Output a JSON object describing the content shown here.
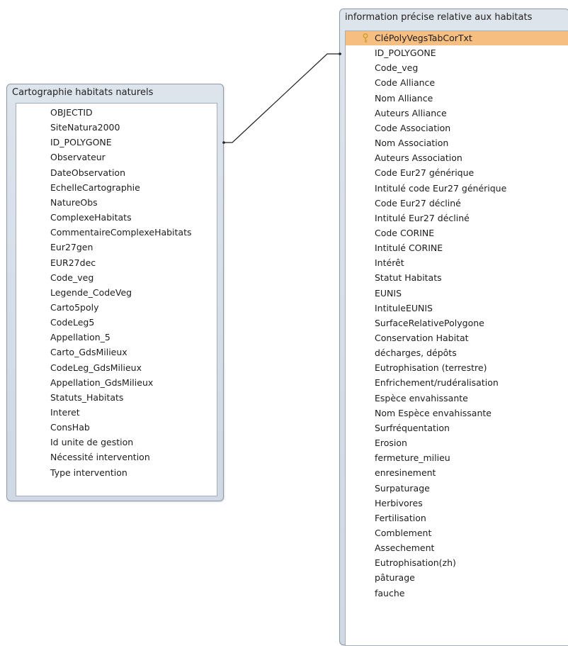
{
  "left_table": {
    "title": "Cartographie habitats naturels",
    "fields": [
      "OBJECTID",
      "SiteNatura2000",
      "ID_POLYGONE",
      "Observateur",
      "DateObservation",
      "EchelleCartographie",
      "NatureObs",
      "ComplexeHabitats",
      "CommentaireComplexeHabitats",
      "Eur27gen",
      "EUR27dec",
      "Code_veg",
      "Legende_CodeVeg",
      "Carto5poly",
      "CodeLeg5",
      "Appellation_5",
      "Carto_GdsMilieux",
      "CodeLeg_GdsMilieux",
      "Appellation_GdsMilieux",
      "Statuts_Habitats",
      "Interet",
      "ConsHab",
      "Id unite de gestion",
      "Nécessité intervention",
      "Type intervention"
    ]
  },
  "right_table": {
    "title": "information précise relative aux habitats",
    "primary_key_field": "CléPolyVegsTabCorTxt",
    "fields": [
      "CléPolyVegsTabCorTxt",
      "ID_POLYGONE",
      "Code_veg",
      "Code Alliance",
      "Nom Alliance",
      "Auteurs Alliance",
      "Code Association",
      "Nom Association",
      "Auteurs Association",
      "Code Eur27 générique",
      "Intitulé code Eur27 générique",
      "Code Eur27 décliné",
      "Intitulé Eur27 décliné",
      "Code CORINE",
      "Intitulé CORINE",
      "Intérêt",
      "Statut Habitats",
      "EUNIS",
      "IntituleEUNIS",
      "SurfaceRelativePolygone",
      "Conservation Habitat",
      "décharges, dépôts",
      "Eutrophisation (terrestre)",
      "Enfrichement/rudéralisation",
      "Espèce envahissante",
      "Nom Espèce envahissante",
      "Surfréquentation",
      "Erosion",
      "fermeture_milieu",
      "enresinement",
      "Surpaturage",
      "Herbivores",
      "Fertilisation",
      "Comblement",
      "Assechement",
      "Eutrophisation(zh)",
      "pâturage",
      "fauche"
    ]
  },
  "relationship": {
    "from_field": "ID_POLYGONE",
    "to_field": "ID_POLYGONE"
  },
  "colors": {
    "selected_row": "#f7be82",
    "window_frame": "#cfd8e3",
    "key_icon": "#c9a227"
  },
  "icons": {
    "primary_key": "key-icon"
  }
}
